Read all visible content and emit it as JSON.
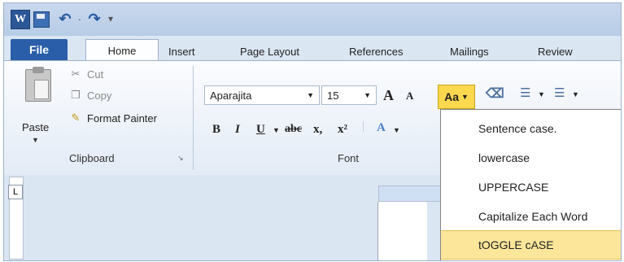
{
  "quick_access": {
    "word_icon": "W",
    "undo_icon": "↶",
    "redo_icon": "↷",
    "separator": "·",
    "more": "▾"
  },
  "tabs": {
    "file": "File",
    "home": "Home",
    "insert": "Insert",
    "page_layout": "Page Layout",
    "references": "References",
    "mailings": "Mailings",
    "review": "Review"
  },
  "clipboard": {
    "paste": "Paste",
    "cut": "Cut",
    "copy": "Copy",
    "format_painter": "Format Painter",
    "group_label": "Clipboard"
  },
  "font": {
    "font_name": "Aparajita",
    "font_size": "15",
    "grow": "A",
    "shrink": "A",
    "change_case": "Aa",
    "bold": "B",
    "italic": "I",
    "underline": "U",
    "strike": "abc",
    "subscript": "x,",
    "superscript": "x²",
    "group_label": "Font"
  },
  "change_case_menu": {
    "items": [
      "Sentence case.",
      "lowercase",
      "UPPERCASE",
      "Capitalize Each Word",
      "tOGGLE cASE"
    ],
    "highlighted_index": 4
  },
  "ruler": {
    "corner": "L"
  },
  "colors": {
    "accent": "#2a5ea8",
    "highlight": "#fbe69a",
    "ribbon_bg": "#dbe6f3"
  }
}
